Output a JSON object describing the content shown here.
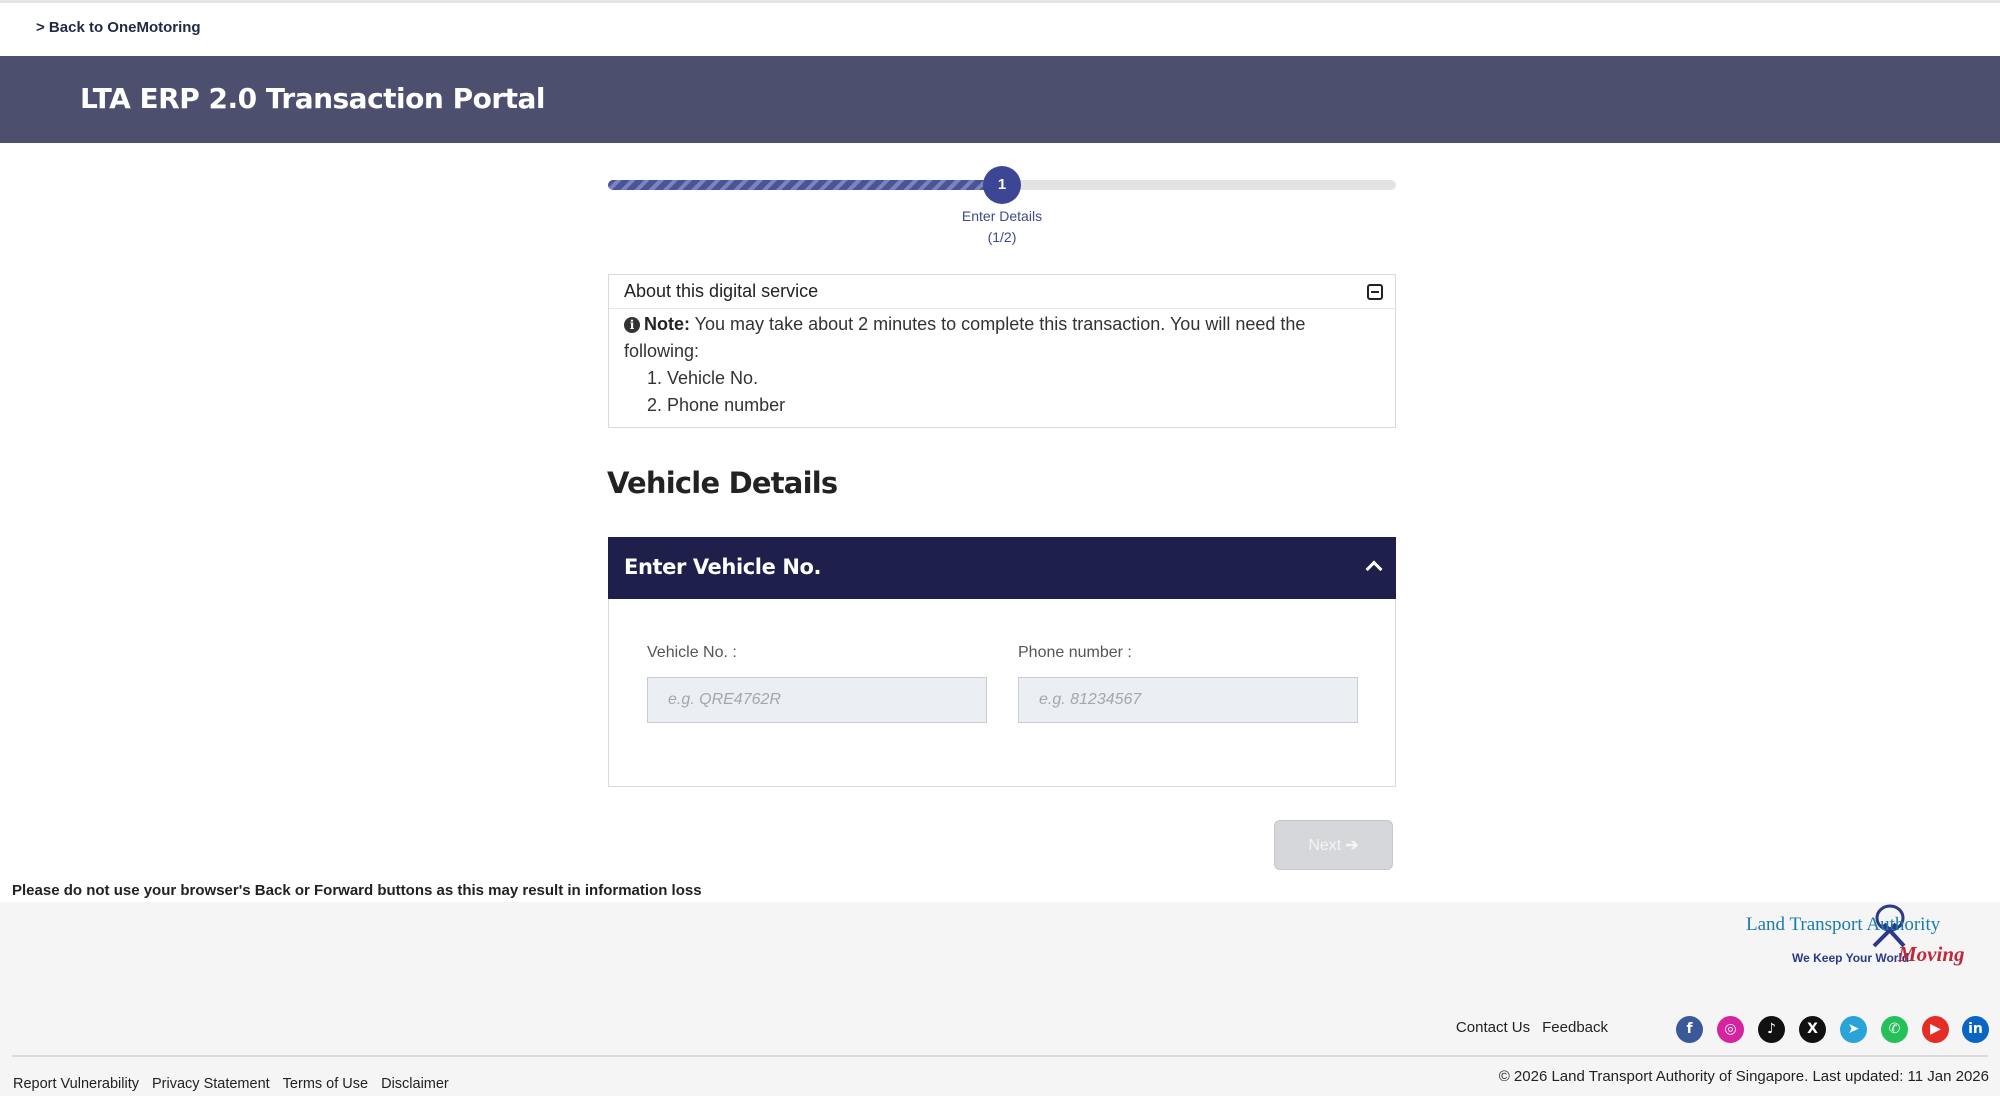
{
  "back_link": "> Back to OneMotoring",
  "header": {
    "title": "LTA ERP 2.0 Transaction Portal"
  },
  "stepper": {
    "step_number": "1",
    "step_name": "Enter Details",
    "step_count": "(1/2)",
    "progress_fraction": 0.5
  },
  "about": {
    "title": "About this digital service",
    "note_label": "Note:",
    "note_text": " You may take about 2 minutes to complete this transaction. You will need the following:",
    "items": [
      "1. Vehicle No.",
      "2. Phone number"
    ]
  },
  "section_title": "Vehicle Details",
  "panel": {
    "title": "Enter Vehicle No.",
    "vehicle_label": "Vehicle No. :",
    "vehicle_placeholder": "e.g. QRE4762R",
    "phone_label": "Phone number :",
    "phone_placeholder": "e.g. 81234567"
  },
  "next_button": {
    "label": "Next",
    "icon": "arrow-right-icon",
    "state": "disabled"
  },
  "warning": "Please do not use your browser's Back or Forward buttons as this may result in information loss",
  "footer": {
    "logo": {
      "name": "Land Transport Authority",
      "tagline": "We Keep Your World",
      "moving": "Moving"
    },
    "contact": "Contact Us",
    "feedback": "Feedback",
    "social": [
      {
        "name": "facebook-icon",
        "glyph": "f",
        "color": "#3b5998"
      },
      {
        "name": "instagram-icon",
        "glyph": "◎",
        "color": "#d6249f"
      },
      {
        "name": "tiktok-icon",
        "glyph": "♪",
        "color": "#111111"
      },
      {
        "name": "x-icon",
        "glyph": "X",
        "color": "#111111"
      },
      {
        "name": "telegram-icon",
        "glyph": "➤",
        "color": "#2aa3d8"
      },
      {
        "name": "whatsapp-icon",
        "glyph": "✆",
        "color": "#25c05a"
      },
      {
        "name": "youtube-icon",
        "glyph": "▶",
        "color": "#e52d27"
      },
      {
        "name": "linkedin-icon",
        "glyph": "in",
        "color": "#0a66c2"
      }
    ],
    "bottom_links": [
      "Report Vulnerability",
      "Privacy Statement",
      "Terms of Use",
      "Disclaimer"
    ],
    "copyright": "© 2026 Land Transport Authority of Singapore. Last updated: 11 Jan 2026"
  },
  "colors": {
    "header": "#4d4f6e",
    "panel_header": "#1e1f4a",
    "accent": "#3d4695"
  }
}
